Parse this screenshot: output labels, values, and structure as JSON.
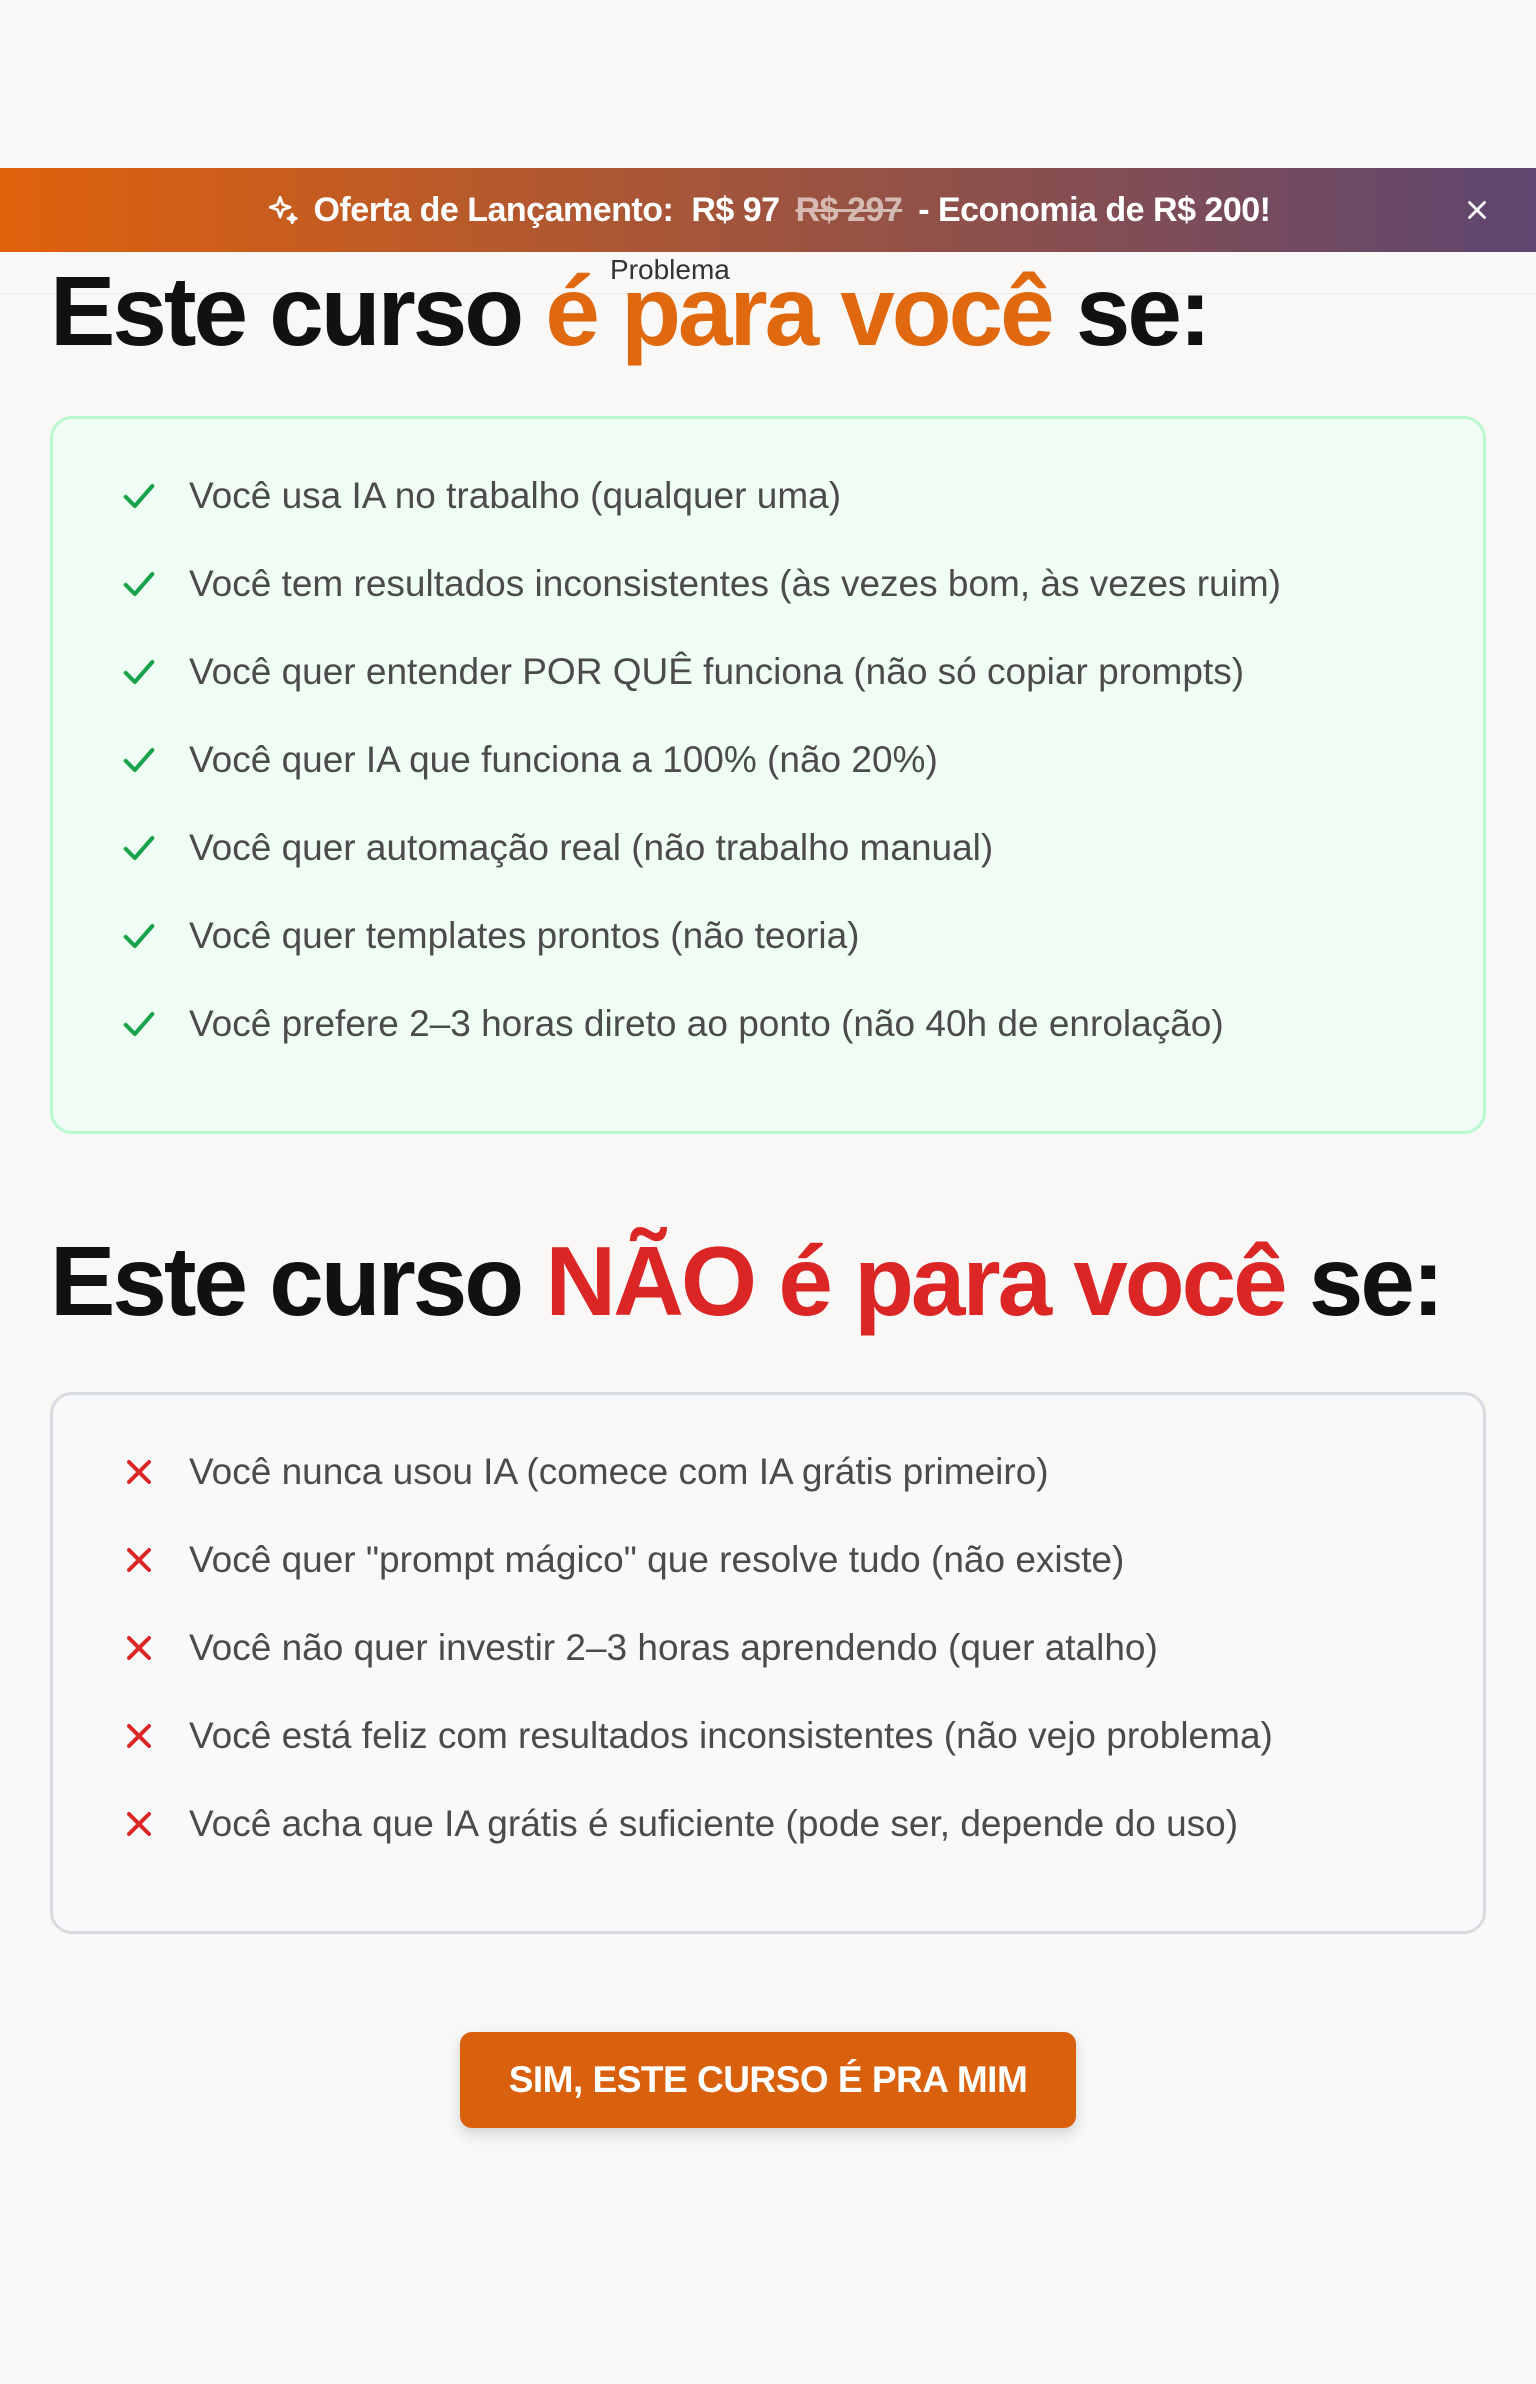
{
  "promo": {
    "label": "Oferta de Lançamento:",
    "price": "R$ 97",
    "old_price": "R$ 297",
    "savings": "- Economia de R$ 200!",
    "gradient_from": "#e0620c",
    "gradient_to": "#5e4670",
    "icons": {
      "leading": "sparkle-icon",
      "trailing": "close-icon"
    }
  },
  "nav": {
    "partial_label": "Problema"
  },
  "section_yes": {
    "title_pre": "Este curso",
    "title_highlight": "é para você",
    "title_post": "se:",
    "highlight_color": "#e0690f",
    "icon": "check-icon",
    "icon_color": "#16a34a",
    "items": [
      "Você usa IA no trabalho (qualquer uma)",
      "Você tem resultados inconsistentes (às vezes bom, às vezes ruim)",
      "Você quer entender POR QUÊ funciona (não só copiar prompts)",
      "Você quer IA que funciona a 100% (não 20%)",
      "Você quer automação real (não trabalho manual)",
      "Você quer templates prontos (não teoria)",
      "Você prefere 2–3 horas direto ao ponto (não 40h de enrolação)"
    ]
  },
  "section_no": {
    "title_pre": "Este curso",
    "title_highlight": "NÃO é para você",
    "title_post": "se:",
    "highlight_color": "#dc2626",
    "icon": "x-icon",
    "icon_color": "#dc2626",
    "items": [
      "Você nunca usou IA (comece com IA grátis primeiro)",
      "Você quer \"prompt mágico\" que resolve tudo (não existe)",
      "Você não quer investir 2–3 horas aprendendo (quer atalho)",
      "Você está feliz com resultados inconsistentes (não vejo problema)",
      "Você acha que IA grátis é suficiente (pode ser, depende do uso)"
    ]
  },
  "cta": {
    "label": "SIM, ESTE CURSO É PRA MIM",
    "color": "#d9600c"
  }
}
